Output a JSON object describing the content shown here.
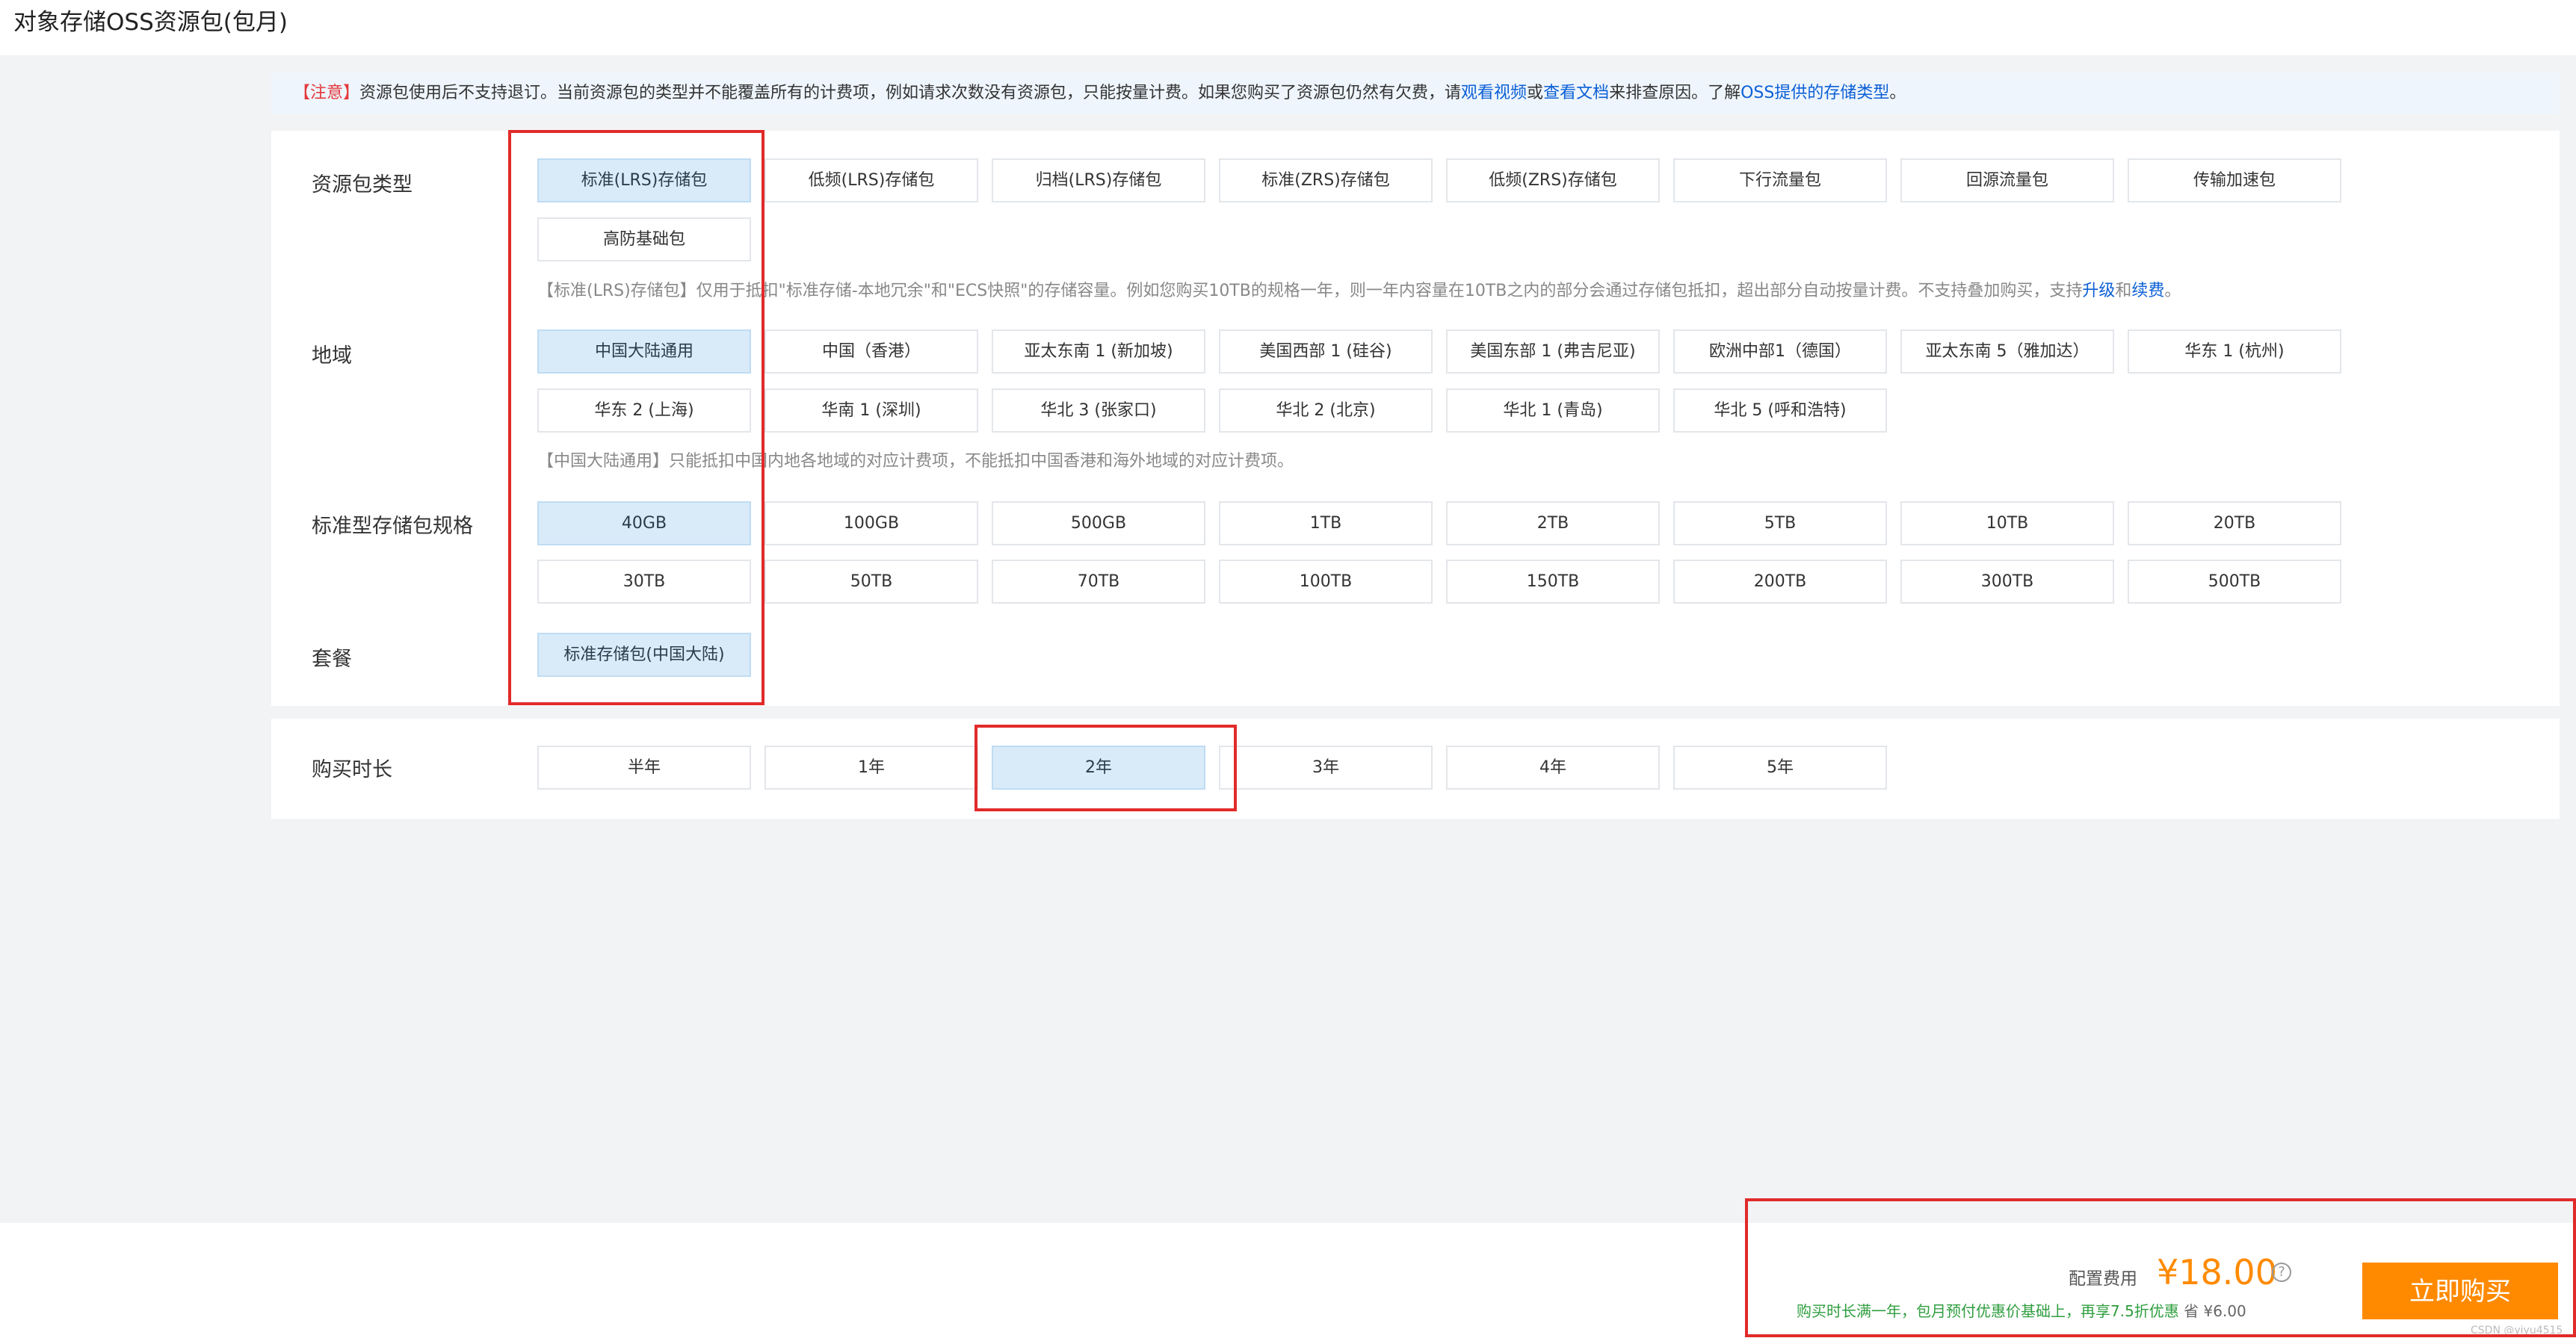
{
  "page_title": "对象存储OSS资源包(包月)",
  "notice": {
    "tag": "【注意】",
    "text": "资源包使用后不支持退订。当前资源包的类型并不能覆盖所有的计费项，例如请求次数没有资源包，只能按量计费。如果您购买了资源包仍然有欠费，请",
    "link1": "观看视频",
    "or": "或",
    "link2": "查看文档",
    "text2": "来排查原因。了解",
    "link3": "OSS提供的存储类型",
    "end": "。"
  },
  "package_type": {
    "label": "资源包类型",
    "options": [
      "标准(LRS)存储包",
      "低频(LRS)存储包",
      "归档(LRS)存储包",
      "标准(ZRS)存储包",
      "低频(ZRS)存储包",
      "下行流量包",
      "回源流量包",
      "传输加速包",
      "高防基础包"
    ],
    "selected": "标准(LRS)存储包",
    "desc": "【标准(LRS)存储包】仅用于抵扣\"标准存储-本地冗余\"和\"ECS快照\"的存储容量。例如您购买10TB的规格一年，则一年内容量在10TB之内的部分会通过存储包抵扣，超出部分自动按量计费。不支持叠加购买，支持",
    "desc_link1": "升级",
    "desc_and": "和",
    "desc_link2": "续费",
    "desc_end": "。"
  },
  "region": {
    "label": "地域",
    "options": [
      "中国大陆通用",
      "中国（香港）",
      "亚太东南 1 (新加坡)",
      "美国西部 1 (硅谷)",
      "美国东部 1 (弗吉尼亚)",
      "欧洲中部1（德国）",
      "亚太东南 5（雅加达）",
      "华东 1 (杭州)",
      "华东 2 (上海)",
      "华南 1 (深圳)",
      "华北 3 (张家口)",
      "华北 2 (北京)",
      "华北 1 (青岛)",
      "华北 5 (呼和浩特)"
    ],
    "selected": "中国大陆通用",
    "desc": "【中国大陆通用】只能抵扣中国内地各地域的对应计费项，不能抵扣中国香港和海外地域的对应计费项。"
  },
  "spec": {
    "label": "标准型存储包规格",
    "options": [
      "40GB",
      "100GB",
      "500GB",
      "1TB",
      "2TB",
      "5TB",
      "10TB",
      "20TB",
      "30TB",
      "50TB",
      "70TB",
      "100TB",
      "150TB",
      "200TB",
      "300TB",
      "500TB"
    ],
    "selected": "40GB"
  },
  "plan": {
    "label": "套餐",
    "options": [
      "标准存储包(中国大陆)"
    ],
    "selected": "标准存储包(中国大陆)"
  },
  "duration": {
    "label": "购买时长",
    "options": [
      "半年",
      "1年",
      "2年",
      "3年",
      "4年",
      "5年"
    ],
    "selected": "2年"
  },
  "footer": {
    "fee_label": "配置费用",
    "price": "¥18.00",
    "help_glyph": "?",
    "discount": "购买时长满一年，包月预付优惠价基础上，再享7.5折优惠",
    "save": "省 ¥6.00",
    "buy_label": "立即购买",
    "watermark": "CSDN @yiyu4515"
  },
  "colors": {
    "accent": "#ff8a00",
    "selected_bg": "#d9ebf9",
    "annotation": "#e12a2a",
    "link": "#0b5fd6",
    "discount": "#2f9e3f"
  }
}
